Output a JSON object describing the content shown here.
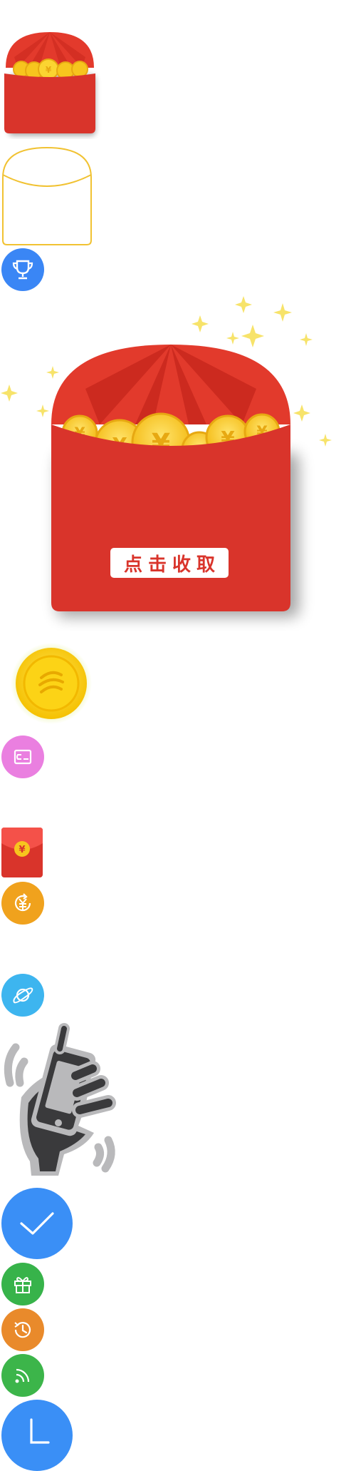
{
  "envelope": {
    "button_label": "点击收取",
    "coin_symbol": "¥"
  },
  "small_envelope": {
    "coin_symbol": "¥"
  },
  "icons": [
    "red-envelope-small-icon",
    "envelope-outline-icon",
    "trophy-icon",
    "big-red-envelope",
    "gold-coin-icon",
    "wallet-icon",
    "red-packet-icon",
    "yuan-refresh-icon",
    "planet-icon",
    "phone-shake-icon",
    "checkmark-icon",
    "gift-icon",
    "history-icon",
    "rss-icon",
    "clock-icon"
  ],
  "colors": {
    "envelope_red": "#d9342b",
    "envelope_dark_red": "#b71c1c",
    "coin_gold": "#f7c51e",
    "outline_gold": "#f1c232",
    "trophy_blue": "#3a86f5",
    "wallet_pink": "#ea7fe0",
    "yuan_orange": "#f0a21d",
    "planet_blue": "#3db5ef",
    "check_blue": "#3a8ff6",
    "gift_green": "#37b34a",
    "history_orange": "#e98a2b",
    "rss_green": "#3cb54a",
    "clock_blue": "#3a8ff6",
    "phone_gray": "#3a3a3c"
  }
}
